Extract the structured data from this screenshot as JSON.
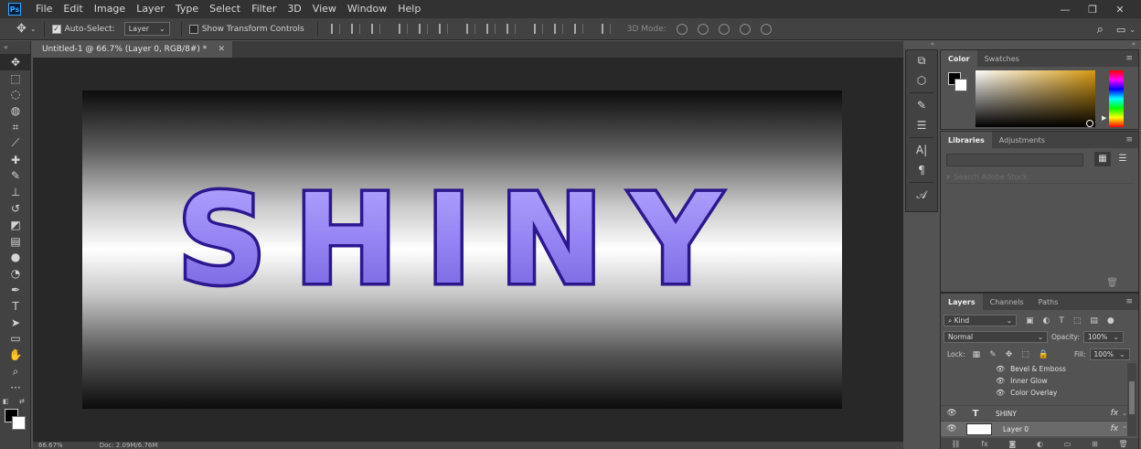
{
  "app": {
    "logo": "Ps"
  },
  "menu": [
    "File",
    "Edit",
    "Image",
    "Layer",
    "Type",
    "Select",
    "Filter",
    "3D",
    "View",
    "Window",
    "Help"
  ],
  "window_controls": {
    "minimize": "—",
    "restore": "❐",
    "close": "✕"
  },
  "options": {
    "auto_select_label": "Auto-Select:",
    "auto_select_checked": true,
    "auto_select_value": "Layer",
    "transform_label": "Show Transform Controls",
    "mode_3d_label": "3D Mode:"
  },
  "document": {
    "tab_title": "Untitled-1 @ 66.7% (Layer 0, RGB/8#) *",
    "close": "✕",
    "canvas_text": "SHINY",
    "text_color": "#8f7ff0",
    "text_stroke": "#2d178f"
  },
  "status": {
    "zoom": "66.67%",
    "doc_info": "Doc: 2.09M/6.76M"
  },
  "panels": {
    "color": {
      "tabs": [
        "Color",
        "Swatches"
      ],
      "active": 0
    },
    "libraries": {
      "tabs": [
        "Libraries",
        "Adjustments"
      ],
      "active": 0,
      "search_placeholder": "Search Adobe Stock"
    },
    "layers": {
      "tabs": [
        "Layers",
        "Channels",
        "Paths"
      ],
      "active": 0,
      "kind_label": "Kind",
      "blend_mode": "Normal",
      "opacity_label": "Opacity:",
      "opacity_value": "100%",
      "lock_label": "Lock:",
      "fill_label": "Fill:",
      "fill_value": "100%",
      "effects": [
        "Bevel & Emboss",
        "Inner Glow",
        "Color Overlay"
      ],
      "layers": [
        {
          "name": "SHINY",
          "type": "text",
          "fx": "fx"
        },
        {
          "name": "Layer 0",
          "type": "pixel",
          "fx": "fx"
        }
      ]
    }
  }
}
